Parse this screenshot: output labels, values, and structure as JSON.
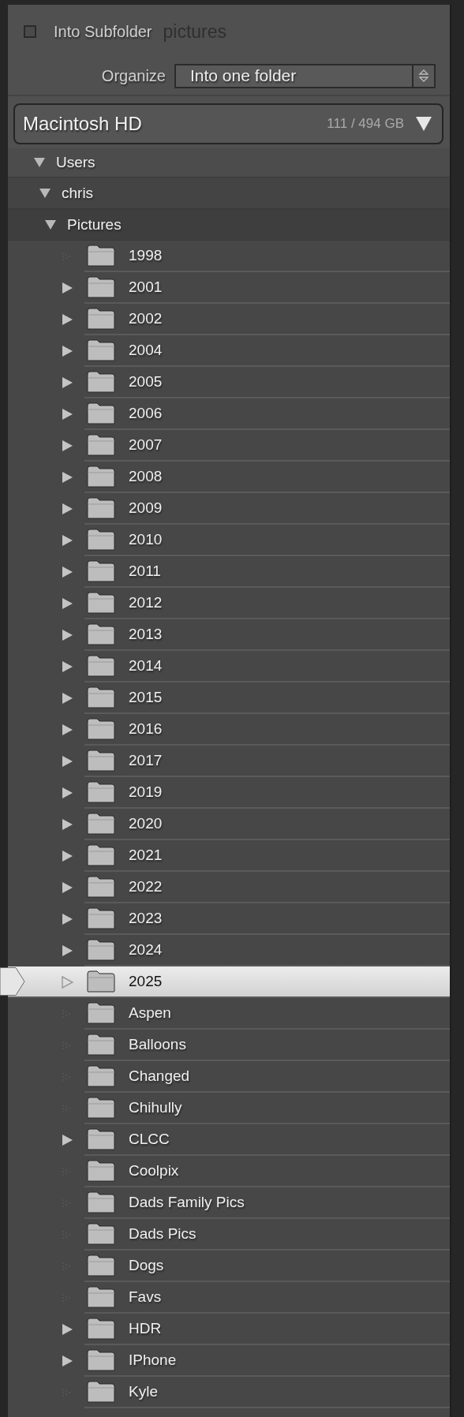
{
  "subfolder": {
    "label": "Into Subfolder",
    "checked": false,
    "value": "pictures"
  },
  "organize": {
    "label": "Organize",
    "value": "Into one folder"
  },
  "volume": {
    "name": "Macintosh HD",
    "usage": "111 / 494 GB",
    "expanded": true
  },
  "tree": [
    {
      "name": "Users",
      "expanded": true,
      "children": [
        {
          "name": "chris",
          "expanded": true,
          "children": [
            {
              "name": "Pictures",
              "expanded": true,
              "children": [
                {
                  "name": "1998",
                  "expandable": false,
                  "selected": false
                },
                {
                  "name": "2001",
                  "expandable": true,
                  "selected": false
                },
                {
                  "name": "2002",
                  "expandable": true,
                  "selected": false
                },
                {
                  "name": "2004",
                  "expandable": true,
                  "selected": false
                },
                {
                  "name": "2005",
                  "expandable": true,
                  "selected": false
                },
                {
                  "name": "2006",
                  "expandable": true,
                  "selected": false
                },
                {
                  "name": "2007",
                  "expandable": true,
                  "selected": false
                },
                {
                  "name": "2008",
                  "expandable": true,
                  "selected": false
                },
                {
                  "name": "2009",
                  "expandable": true,
                  "selected": false
                },
                {
                  "name": "2010",
                  "expandable": true,
                  "selected": false
                },
                {
                  "name": "2011",
                  "expandable": true,
                  "selected": false
                },
                {
                  "name": "2012",
                  "expandable": true,
                  "selected": false
                },
                {
                  "name": "2013",
                  "expandable": true,
                  "selected": false
                },
                {
                  "name": "2014",
                  "expandable": true,
                  "selected": false
                },
                {
                  "name": "2015",
                  "expandable": true,
                  "selected": false
                },
                {
                  "name": "2016",
                  "expandable": true,
                  "selected": false
                },
                {
                  "name": "2017",
                  "expandable": true,
                  "selected": false
                },
                {
                  "name": "2019",
                  "expandable": true,
                  "selected": false
                },
                {
                  "name": "2020",
                  "expandable": true,
                  "selected": false
                },
                {
                  "name": "2021",
                  "expandable": true,
                  "selected": false
                },
                {
                  "name": "2022",
                  "expandable": true,
                  "selected": false
                },
                {
                  "name": "2023",
                  "expandable": true,
                  "selected": false
                },
                {
                  "name": "2024",
                  "expandable": true,
                  "selected": false
                },
                {
                  "name": "2025",
                  "expandable": true,
                  "selected": true
                },
                {
                  "name": "Aspen",
                  "expandable": false,
                  "selected": false
                },
                {
                  "name": "Balloons",
                  "expandable": false,
                  "selected": false
                },
                {
                  "name": "Changed",
                  "expandable": false,
                  "selected": false
                },
                {
                  "name": "Chihully",
                  "expandable": false,
                  "selected": false
                },
                {
                  "name": "CLCC",
                  "expandable": true,
                  "selected": false
                },
                {
                  "name": "Coolpix",
                  "expandable": false,
                  "selected": false
                },
                {
                  "name": "Dads Family Pics",
                  "expandable": false,
                  "selected": false
                },
                {
                  "name": "Dads Pics",
                  "expandable": false,
                  "selected": false
                },
                {
                  "name": "Dogs",
                  "expandable": false,
                  "selected": false
                },
                {
                  "name": "Favs",
                  "expandable": false,
                  "selected": false
                },
                {
                  "name": "HDR",
                  "expandable": true,
                  "selected": false
                },
                {
                  "name": "IPhone",
                  "expandable": true,
                  "selected": false
                },
                {
                  "name": "Kyle",
                  "expandable": false,
                  "selected": false
                }
              ]
            }
          ]
        }
      ]
    }
  ]
}
